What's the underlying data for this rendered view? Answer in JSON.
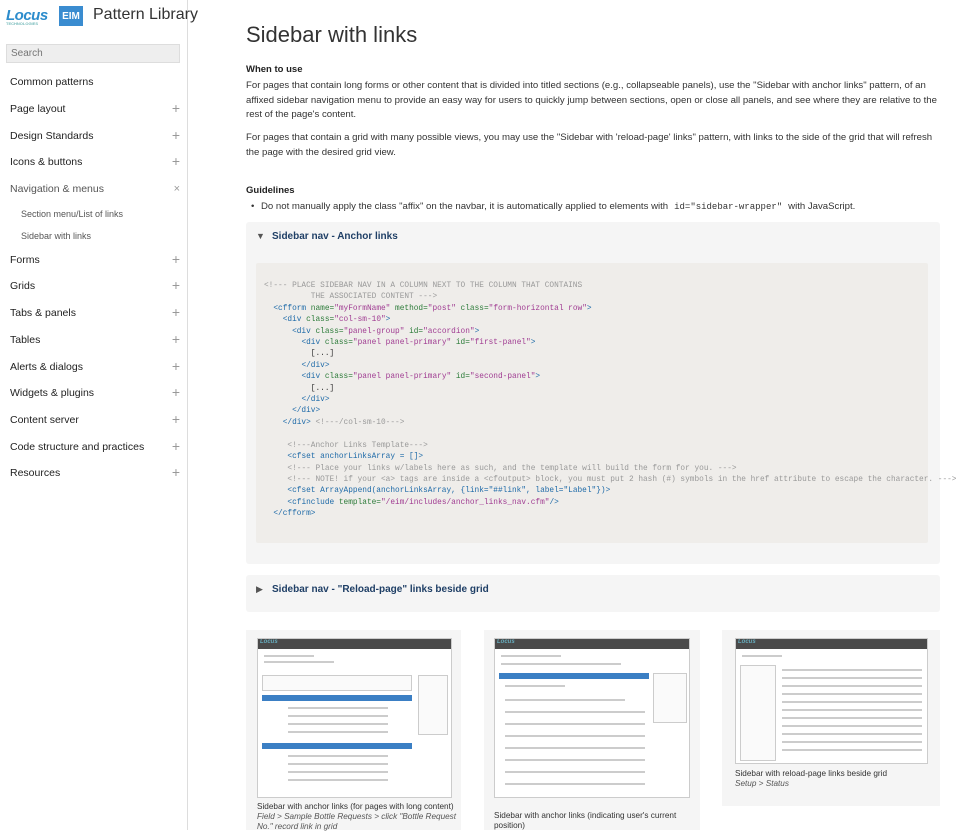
{
  "brand": {
    "logo": "Locus",
    "logo_tag": "TECHNOLOGIES",
    "badge": "EIM",
    "title": "Pattern Library"
  },
  "search": {
    "placeholder": "Search"
  },
  "nav": [
    {
      "label": "Common patterns",
      "toggle": ""
    },
    {
      "label": "Page layout",
      "toggle": "+"
    },
    {
      "label": "Design Standards",
      "toggle": "+"
    },
    {
      "label": "Icons & buttons",
      "toggle": "+"
    },
    {
      "label": "Navigation & menus",
      "toggle": "×"
    },
    {
      "label": "Forms",
      "toggle": "+"
    },
    {
      "label": "Grids",
      "toggle": "+"
    },
    {
      "label": "Tabs & panels",
      "toggle": "+"
    },
    {
      "label": "Tables",
      "toggle": "+"
    },
    {
      "label": "Alerts & dialogs",
      "toggle": "+"
    },
    {
      "label": "Widgets & plugins",
      "toggle": "+"
    },
    {
      "label": "Content server",
      "toggle": "+"
    },
    {
      "label": "Code structure and practices",
      "toggle": "+"
    },
    {
      "label": "Resources",
      "toggle": "+"
    }
  ],
  "subnav": [
    "Section menu/List of links",
    "Sidebar with links"
  ],
  "page": {
    "title": "Sidebar with links",
    "when_heading": "When to use",
    "para1": "For pages that contain long forms or other content that is divided into titled sections (e.g., collapseable panels), use the \"Sidebar with anchor links\" pattern, of an affixed sidebar navigation menu to provide an easy way for users to quickly jump between sections, open or close all panels, and see where they are relative to the rest of the page's content.",
    "para2": "For pages that contain a grid with many possible views, you may use the \"Sidebar with 'reload-page' links\" pattern, with links to the side of the grid that will refresh the page with the desired grid view.",
    "guidelines_heading": "Guidelines",
    "bullet_pre": "Do not manually apply the class \"affix\" on the navbar, it is automatically applied to elements with",
    "bullet_code": "id=\"sidebar-wrapper\"",
    "bullet_post": "with JavaScript."
  },
  "panels": [
    {
      "title": "Sidebar nav - Anchor links",
      "caret": "▼"
    },
    {
      "title": "Sidebar nav - \"Reload-page\" links beside grid",
      "caret": "▶"
    }
  ],
  "code": {
    "l1": "<!--- PLACE SIDEBAR NAV IN A COLUMN NEXT TO THE COLUMN THAT CONTAINS",
    "l2": "THE ASSOCIATED CONTENT --->",
    "l3a": "<cfform ",
    "l3b": "name=",
    "l3c": "\"myFormName\"",
    "l3d": " method=",
    "l3e": "\"post\"",
    "l3f": " class=",
    "l3g": "\"form-horizontal row\"",
    "l3h": ">",
    "l4a": "<div ",
    "l4b": "class=",
    "l4c": "\"col-sm-10\"",
    "l4d": ">",
    "l5a": "<div ",
    "l5b": "class=",
    "l5c": "\"panel-group\"",
    "l5d": " id=",
    "l5e": "\"accordion\"",
    "l5f": ">",
    "l6a": "<div ",
    "l6b": "class=",
    "l6c": "\"panel panel-primary\"",
    "l6d": " id=",
    "l6e": "\"first-panel\"",
    "l6f": ">",
    "l7": "[...]",
    "l8": "</div>",
    "l9a": "<div ",
    "l9b": "class=",
    "l9c": "\"panel panel-primary\"",
    "l9d": " id=",
    "l9e": "\"second-panel\"",
    "l9f": ">",
    "l10": "[...]",
    "l11": "</div>",
    "l12": "</div>",
    "l13a": "</div>",
    "l13b": " <!---/col-sm-10--->",
    "l14": "<!---Anchor Links Template--->",
    "l15": "<cfset anchorLinksArray = []>",
    "l16": "<!--- Place your links w/labels here as such, and the template will build the form for you. --->",
    "l17": "<!--- NOTE! if your <a> tags are inside a <cfoutput> block, you must put 2 hash (#) symbols in the href attribute to escape the character. --->",
    "l18": "<cfset ArrayAppend(anchorLinksArray, {link=\"##link\", label=\"Label\"})>",
    "l19a": "<cfinclude ",
    "l19b": "template=",
    "l19c": "\"/eim/includes/anchor_links_nav.cfm\"",
    "l19d": "/>",
    "l20": "</cfform>"
  },
  "thumbs": [
    {
      "title": "Sidebar with anchor links (for pages with long content)",
      "path": "Field > Sample Bottle Requests > click \"Bottle Request No.\" record link in grid"
    },
    {
      "title": "Sidebar with anchor links (indicating user's current position)",
      "path": ""
    },
    {
      "title": "Sidebar with reload-page links beside grid",
      "path": "Setup > Status"
    }
  ]
}
